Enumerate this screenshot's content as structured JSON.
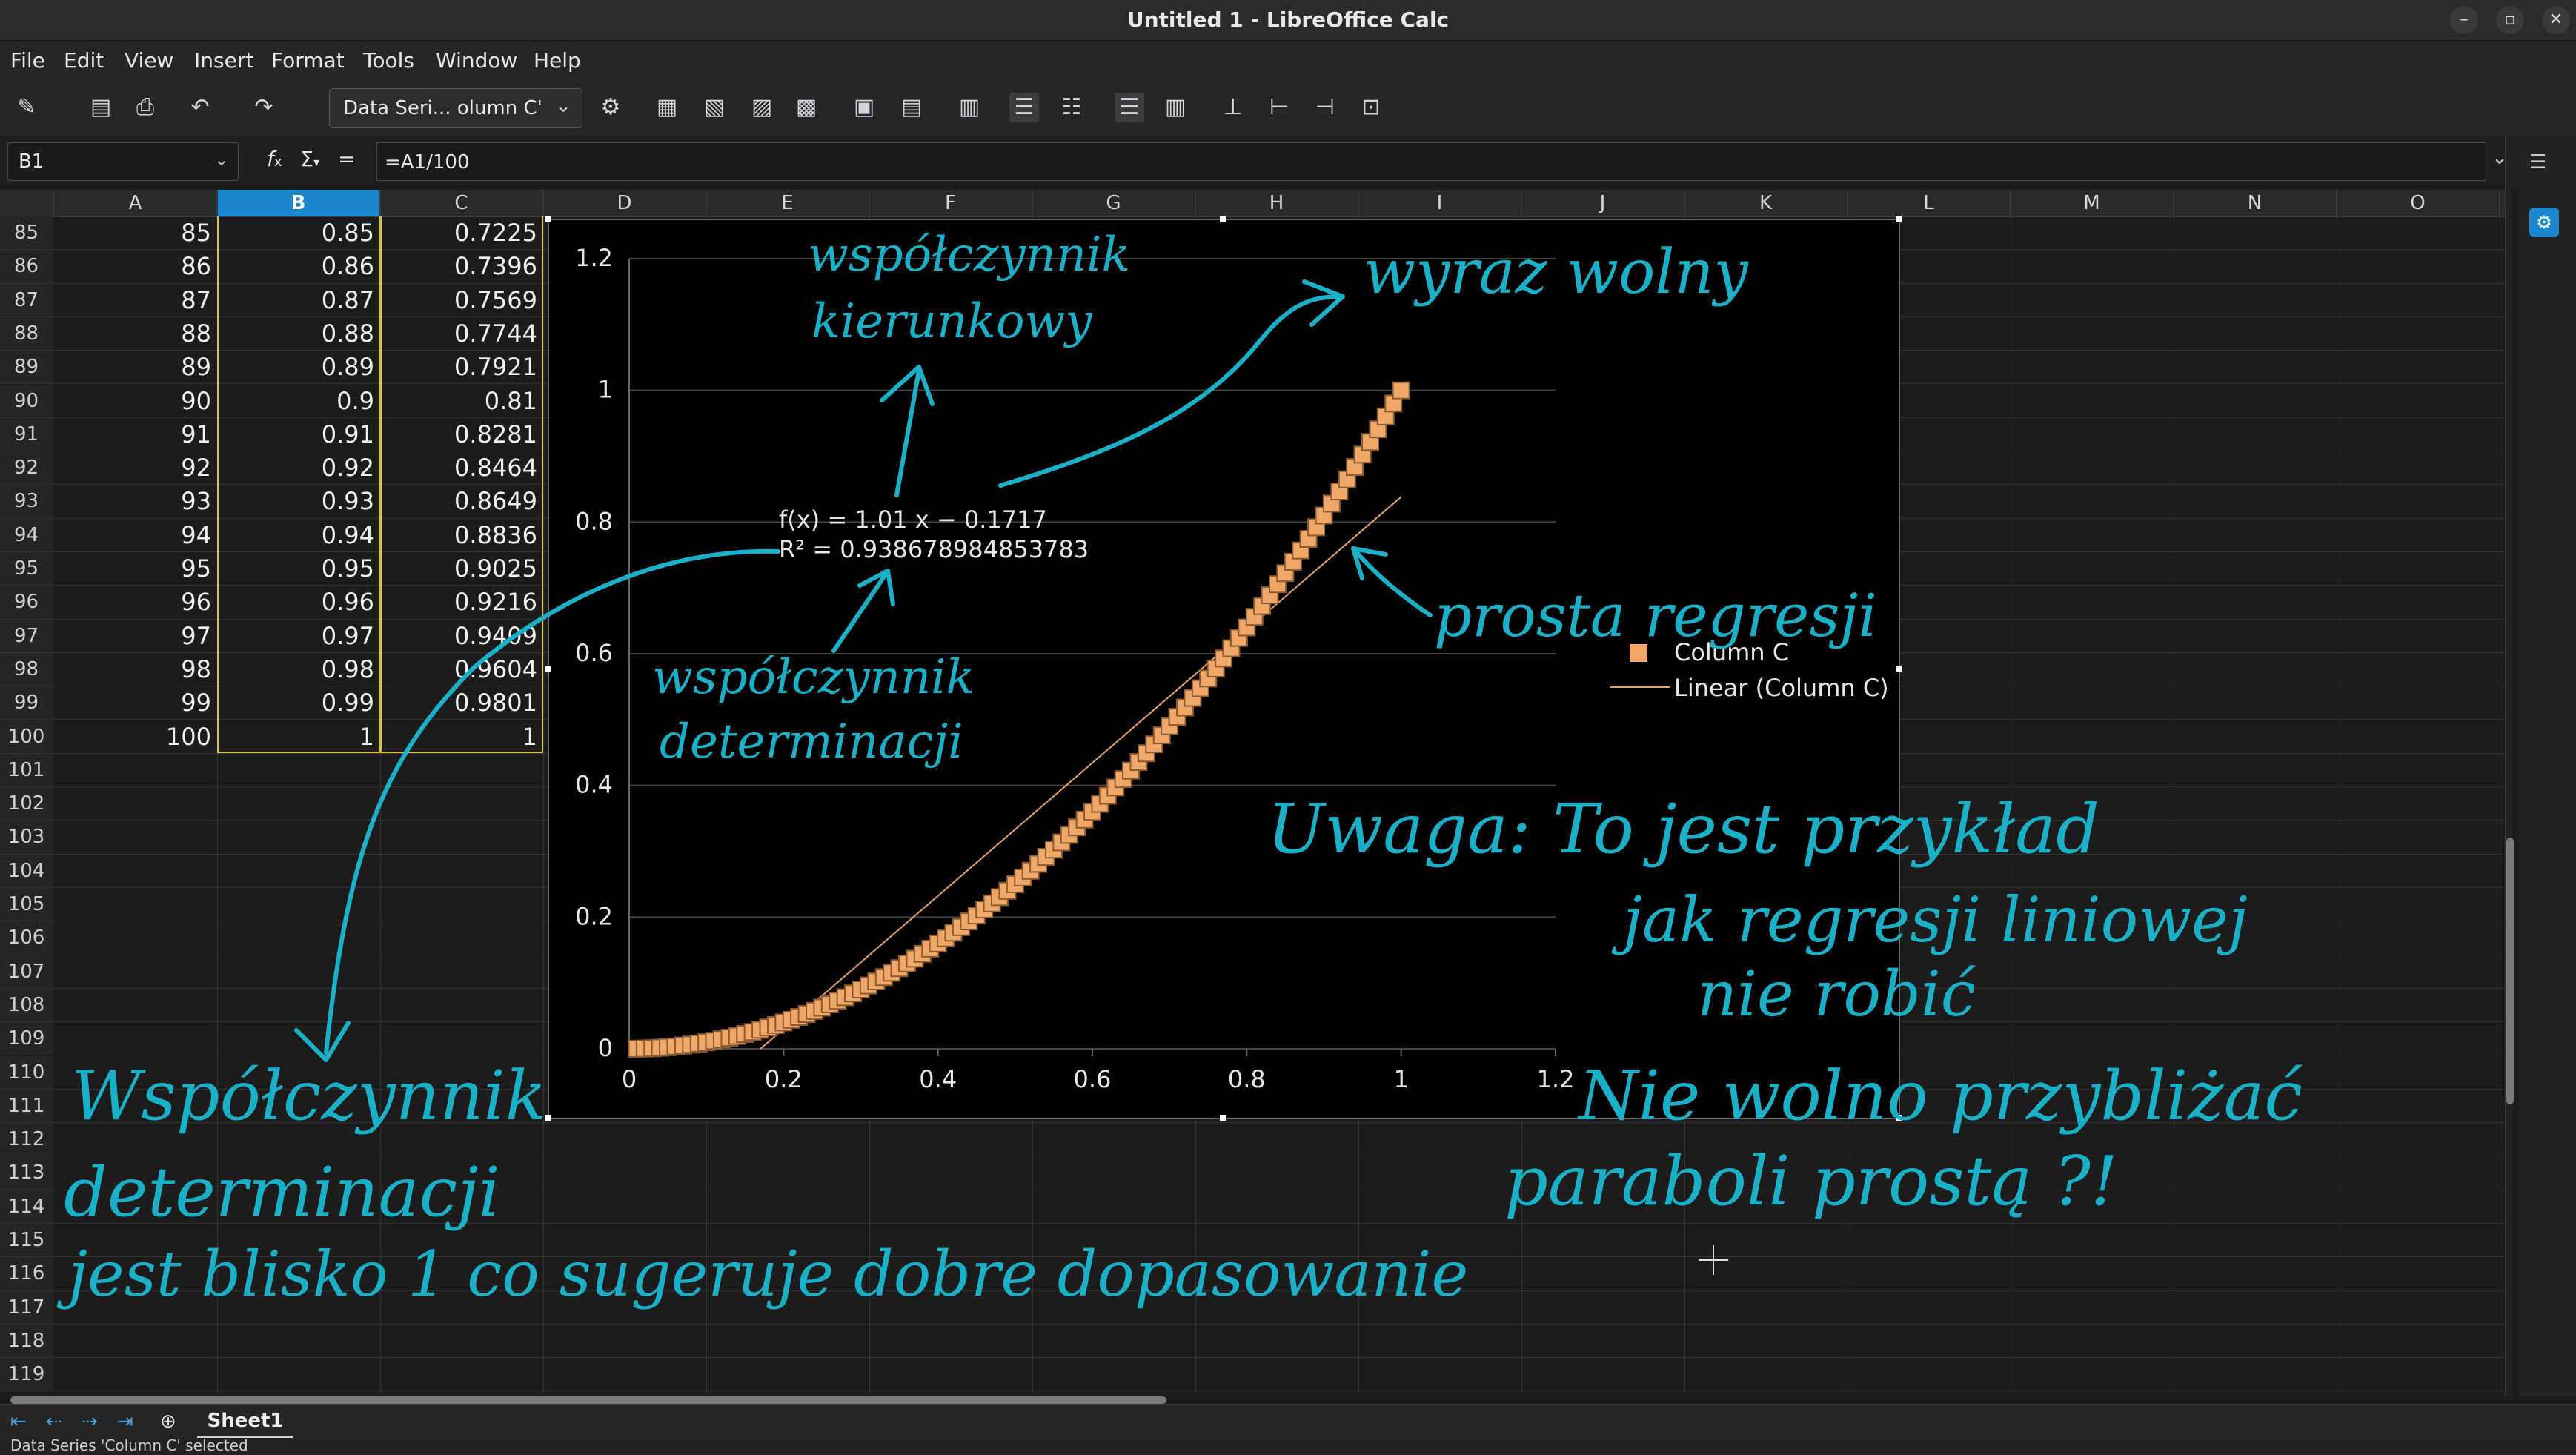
{
  "window": {
    "title": "Untitled 1 - LibreOffice Calc"
  },
  "menu": [
    "File",
    "Edit",
    "View",
    "Insert",
    "Format",
    "Tools",
    "Window",
    "Help"
  ],
  "toolbar": {
    "paragraph_style": "Data Seri... olumn C'"
  },
  "formula_bar": {
    "name_box": "B1",
    "fx": "f",
    "sum": "Σ",
    "eq": "=",
    "formula": "=A1/100"
  },
  "columns": [
    "A",
    "B",
    "C",
    "D",
    "E",
    "F",
    "G",
    "H",
    "I",
    "J",
    "K",
    "L",
    "M",
    "N",
    "O"
  ],
  "selected_column": "B",
  "rows": [
    {
      "n": "85",
      "a": "85",
      "b": "0.85",
      "c": "0.7225"
    },
    {
      "n": "86",
      "a": "86",
      "b": "0.86",
      "c": "0.7396"
    },
    {
      "n": "87",
      "a": "87",
      "b": "0.87",
      "c": "0.7569"
    },
    {
      "n": "88",
      "a": "88",
      "b": "0.88",
      "c": "0.7744"
    },
    {
      "n": "89",
      "a": "89",
      "b": "0.89",
      "c": "0.7921"
    },
    {
      "n": "90",
      "a": "90",
      "b": "0.9",
      "c": "0.81"
    },
    {
      "n": "91",
      "a": "91",
      "b": "0.91",
      "c": "0.8281"
    },
    {
      "n": "92",
      "a": "92",
      "b": "0.92",
      "c": "0.8464"
    },
    {
      "n": "93",
      "a": "93",
      "b": "0.93",
      "c": "0.8649"
    },
    {
      "n": "94",
      "a": "94",
      "b": "0.94",
      "c": "0.8836"
    },
    {
      "n": "95",
      "a": "95",
      "b": "0.95",
      "c": "0.9025"
    },
    {
      "n": "96",
      "a": "96",
      "b": "0.96",
      "c": "0.9216"
    },
    {
      "n": "97",
      "a": "97",
      "b": "0.97",
      "c": "0.9409"
    },
    {
      "n": "98",
      "a": "98",
      "b": "0.98",
      "c": "0.9604"
    },
    {
      "n": "99",
      "a": "99",
      "b": "0.99",
      "c": "0.9801"
    },
    {
      "n": "100",
      "a": "100",
      "b": "1",
      "c": "1"
    },
    {
      "n": "101",
      "a": "",
      "b": "",
      "c": ""
    },
    {
      "n": "102",
      "a": "",
      "b": "",
      "c": ""
    },
    {
      "n": "103",
      "a": "",
      "b": "",
      "c": ""
    },
    {
      "n": "104",
      "a": "",
      "b": "",
      "c": ""
    },
    {
      "n": "105",
      "a": "",
      "b": "",
      "c": ""
    },
    {
      "n": "106",
      "a": "",
      "b": "",
      "c": ""
    },
    {
      "n": "107",
      "a": "",
      "b": "",
      "c": ""
    },
    {
      "n": "108",
      "a": "",
      "b": "",
      "c": ""
    },
    {
      "n": "109",
      "a": "",
      "b": "",
      "c": ""
    },
    {
      "n": "110",
      "a": "",
      "b": "",
      "c": ""
    },
    {
      "n": "111",
      "a": "",
      "b": "",
      "c": ""
    },
    {
      "n": "112",
      "a": "",
      "b": "",
      "c": ""
    },
    {
      "n": "113",
      "a": "",
      "b": "",
      "c": ""
    },
    {
      "n": "114",
      "a": "",
      "b": "",
      "c": ""
    },
    {
      "n": "115",
      "a": "",
      "b": "",
      "c": ""
    },
    {
      "n": "116",
      "a": "",
      "b": "",
      "c": ""
    },
    {
      "n": "117",
      "a": "",
      "b": "",
      "c": ""
    },
    {
      "n": "118",
      "a": "",
      "b": "",
      "c": ""
    },
    {
      "n": "119",
      "a": "",
      "b": "",
      "c": ""
    }
  ],
  "chart_data": {
    "type": "scatter",
    "x_ticks": [
      "0",
      "0.2",
      "0.4",
      "0.6",
      "0.8",
      "1",
      "1.2"
    ],
    "y_ticks": [
      "0",
      "0.2",
      "0.4",
      "0.6",
      "0.8",
      "1",
      "1.2"
    ],
    "xlim": [
      0,
      1.2
    ],
    "ylim": [
      0,
      1.2
    ],
    "grid": "horizontal",
    "legend_position": "right",
    "series": [
      {
        "name": "Column C",
        "x_from": 0.01,
        "x_to": 1.0,
        "x_step": 0.01,
        "formula": "y = x^2",
        "color": "#f0a868"
      },
      {
        "name": "Linear (Column C)",
        "slope": 1.01,
        "intercept": -0.1717,
        "x_range": [
          0.17,
          1.0
        ],
        "color": "#e8a060"
      }
    ],
    "trendline_equation": "f(x) = 1.01 x − 0.1717",
    "r_squared_label": "R² = 0.938678984853783"
  },
  "annotations": {
    "color": "#1ab0c8",
    "slope": [
      "współczynnik",
      "kierunkowy"
    ],
    "intercept": "wyraz wolny",
    "determination": [
      "współczynnik",
      "determinacji"
    ],
    "regression_line": "prosta regresji",
    "note_1": [
      "Uwaga: To jest przykład",
      "jak regresji liniowej",
      "nie robić"
    ],
    "note_2": [
      "Nie wolno przybliżać",
      "paraboli prostą ?!"
    ],
    "note_3": [
      "Współczynnik",
      "determinacji",
      "jest blisko 1 co sugeruje dobre dopasowanie"
    ]
  },
  "sheet_tabs": [
    "Sheet1"
  ],
  "status": "Data Series 'Column C' selected"
}
